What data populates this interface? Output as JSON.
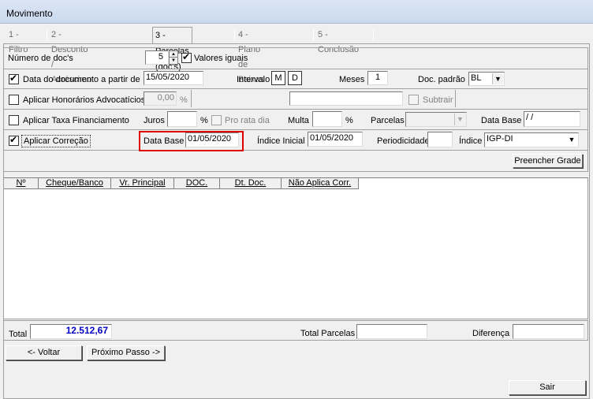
{
  "window": {
    "title": "Movimento"
  },
  "tabs": [
    {
      "label": "1 - Filtro"
    },
    {
      "label": "2 - Desconto / Acréscimo"
    },
    {
      "label": "3 - Parcelas (doc's)"
    },
    {
      "label": "4 - Plano de Baixas"
    },
    {
      "label": "5 - Conclusão"
    }
  ],
  "docs": {
    "num_label": "Número de doc's",
    "num_value": "5",
    "valores_iguais_label": "Valores iguais"
  },
  "data_doc": {
    "label": "Data do documento a partir de",
    "value": "15/05/2020",
    "intervalo_label": "Intervalo",
    "m_label": "M",
    "d_label": "D",
    "meses_label": "Meses",
    "meses_value": "1",
    "doc_padrao_label": "Doc. padrão",
    "doc_padrao_value": "BL"
  },
  "honorarios": {
    "label": "Aplicar Honorários Advocatícios",
    "value": "0,00",
    "pct": "%",
    "subtrair_label": "Subtrair"
  },
  "taxa": {
    "label": "Aplicar Taxa Financiamento",
    "juros_label": "Juros",
    "pct": "%",
    "pro_rata_label": "Pro rata dia",
    "multa_label": "Multa",
    "multa_pct": "%",
    "parcelas_label": "Parcelas",
    "data_base_label": "Data Base",
    "data_base_value": " / /"
  },
  "correcao": {
    "label": "Aplicar Correção",
    "data_base_label": "Data Base",
    "data_base_value": "01/05/2020",
    "indice_inicial_label": "Índice Inicial",
    "indice_inicial_value": "01/05/2020",
    "periodicidade_label": "Periodicidade",
    "indice_label": "Índice",
    "indice_value": "IGP-DI"
  },
  "preencher_label": "Preencher Grade",
  "grid": {
    "columns": [
      "Nº",
      "Cheque/Banco",
      "Vr. Principal",
      "DOC.",
      "Dt. Doc.",
      "Não Aplica Corr."
    ]
  },
  "totals": {
    "total_label": "Total",
    "total_value": "12.512,67",
    "total_parcelas_label": "Total Parcelas",
    "diferenca_label": "Diferença"
  },
  "nav": {
    "voltar_label": "<- Voltar",
    "proximo_label": "Próximo Passo ->",
    "sair_label": "Sair"
  },
  "colors": {
    "highlight": "#e00000",
    "total_value": "#0000c0"
  }
}
